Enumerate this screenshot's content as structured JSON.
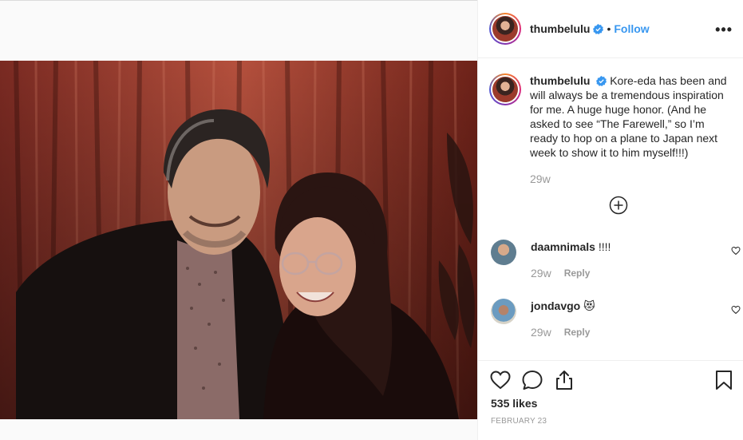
{
  "post": {
    "photo_alt": "Photo",
    "author": {
      "username": "thumbelulu",
      "verified": true,
      "follow_label": "Follow",
      "separator": "•"
    },
    "more_label": "•••",
    "caption": {
      "username": "thumbelulu",
      "text": "Kore-eda has been and will always be a tremendous inspiration for me. A huge huge honor. (And he asked to see “The Farewell,” so I’m ready to hop on a plane to Japan next week to show it to him myself!!!)",
      "time": "29w"
    },
    "comments": [
      {
        "username": "daamnimals",
        "text": "!!!!",
        "time": "29w",
        "reply_label": "Reply"
      },
      {
        "username": "jondavgo",
        "text": "😻",
        "time": "29w",
        "reply_label": "Reply"
      }
    ],
    "likes": "535 likes",
    "date": "FEBRUARY 23",
    "icons": {
      "like": "heart-outline-icon",
      "comment": "speech-bubble-icon",
      "share": "share-icon",
      "save": "bookmark-icon",
      "load_more": "plus-circle-icon"
    },
    "colors": {
      "link_blue": "#3897f0",
      "verified_blue": "#3897f0",
      "muted": "#999999",
      "text": "#262626"
    }
  }
}
